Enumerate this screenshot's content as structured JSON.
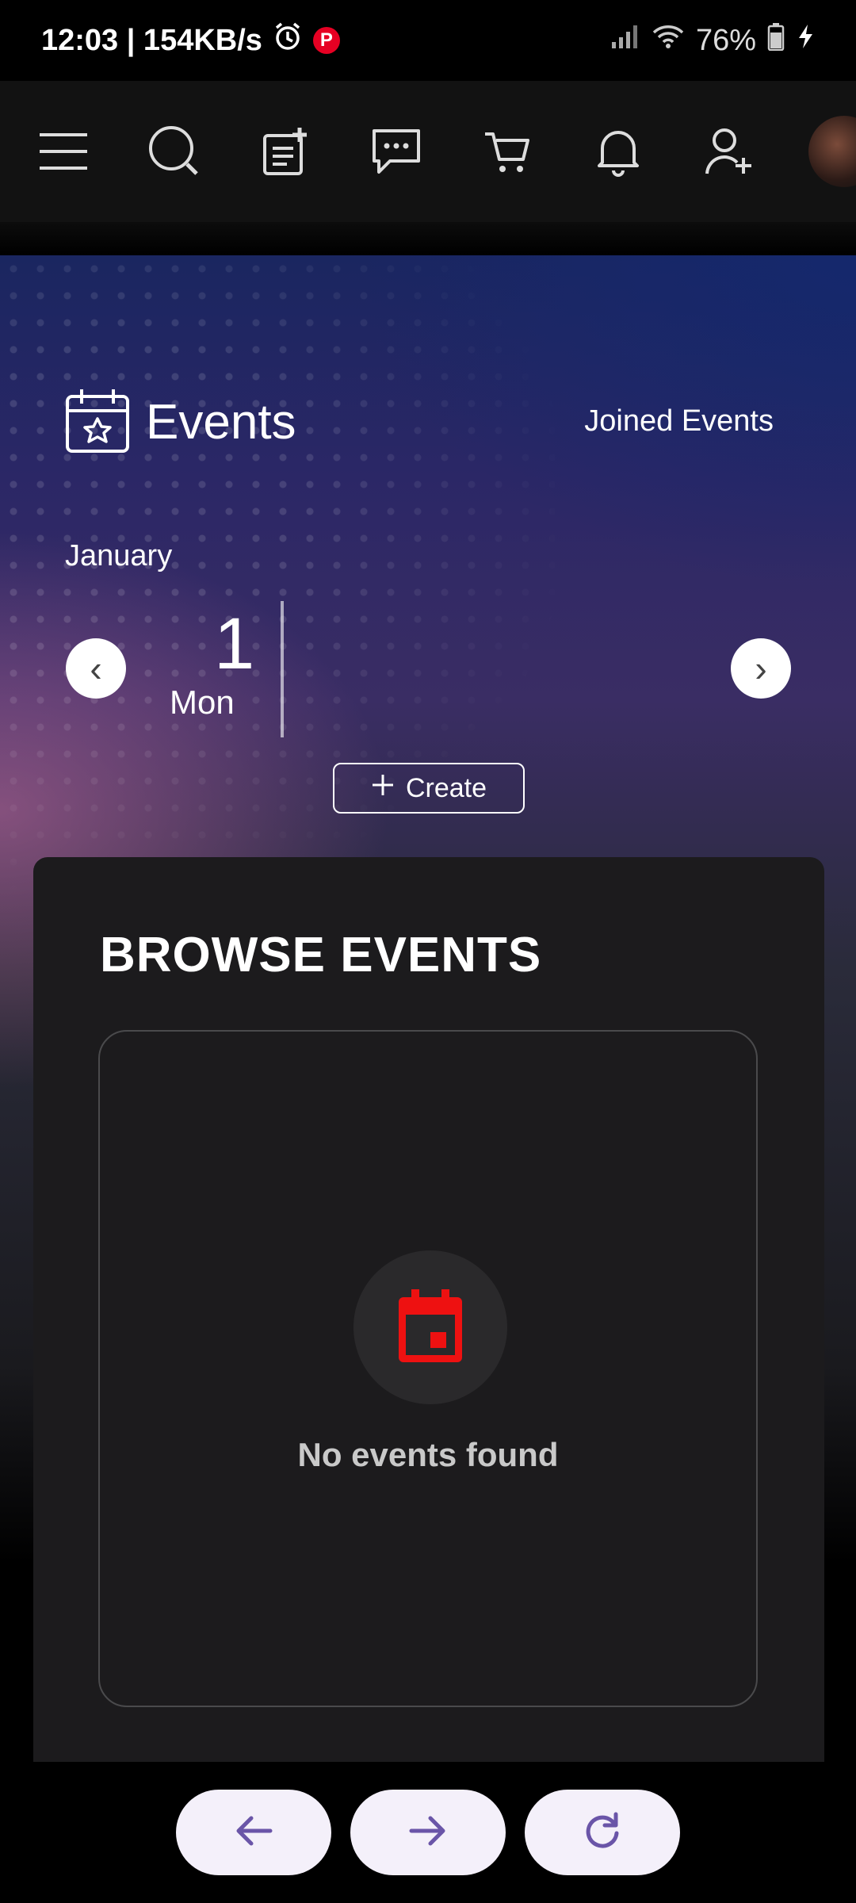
{
  "status_bar": {
    "time_speed": "12:03 | 154KB/s",
    "battery": "76%",
    "icons": [
      "alarm-icon",
      "pinterest-icon",
      "signal-icon",
      "wifi-icon",
      "battery-icon",
      "charging-icon"
    ]
  },
  "top_nav": {
    "icons": [
      "menu-icon",
      "search-icon",
      "new-post-icon",
      "messages-icon",
      "cart-icon",
      "notifications-icon",
      "add-friend-icon",
      "avatar"
    ]
  },
  "header": {
    "title": "Events",
    "joined_link": "Joined Events"
  },
  "calendar": {
    "month": "January",
    "day_number": "1",
    "day_name": "Mon",
    "prev_glyph": "‹",
    "next_glyph": "›"
  },
  "create_button": {
    "label": "Create"
  },
  "browse": {
    "title": "BROWSE EVENTS",
    "empty_message": "No events found"
  },
  "colors": {
    "accent_red": "#ee1111",
    "nav_icon_purple": "#6a55a8",
    "card_bg": "#1c1b1d"
  }
}
